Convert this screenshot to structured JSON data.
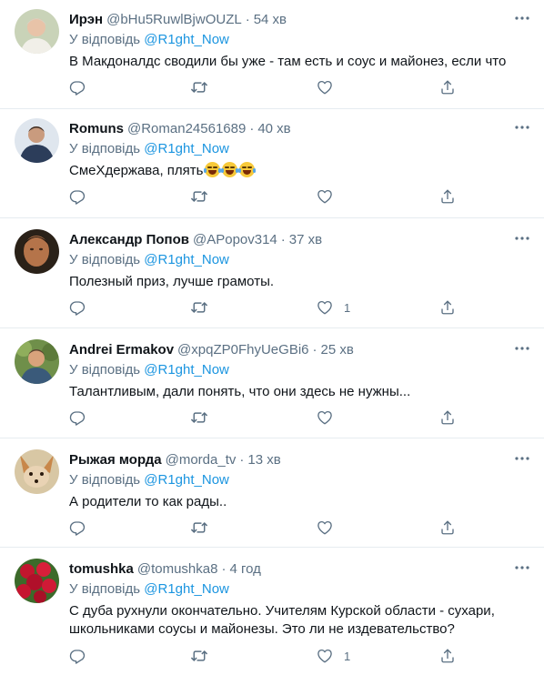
{
  "tweets": [
    {
      "name": "Ирэн",
      "handle": "@bHu5RuwlBjwOUZL",
      "time": "54 хв",
      "reply_prefix": "У відповідь",
      "reply_mention": "@R1ght_Now",
      "text": "В Макдоналдс сводили бы уже - там есть и соус и майонез, если что",
      "like_count": "",
      "avatar_icon": "avatar-photo-woman"
    },
    {
      "name": "Romuns",
      "handle": "@Roman24561689",
      "time": "40 хв",
      "reply_prefix": "У відповідь",
      "reply_mention": "@R1ght_Now",
      "text": "СмеХдержава, плять",
      "emoji_count": 3,
      "like_count": "",
      "avatar_icon": "avatar-photo-man"
    },
    {
      "name": "Александр Попов",
      "handle": "@APopov314",
      "time": "37 хв",
      "reply_prefix": "У відповідь",
      "reply_mention": "@R1ght_Now",
      "text": "Полезный приз, лучше грамоты.",
      "like_count": "1",
      "avatar_icon": "avatar-photo-man-dark"
    },
    {
      "name": "Andrei Ermakov",
      "handle": "@xpqZP0FhyUeGBi6",
      "time": "25 хв",
      "reply_prefix": "У відповідь",
      "reply_mention": "@R1ght_Now",
      "text": "Талантливым, дали понять, что они здесь не нужны...",
      "like_count": "",
      "avatar_icon": "avatar-photo-man-outdoor"
    },
    {
      "name": "Рыжая морда",
      "handle": "@morda_tv",
      "time": "13 хв",
      "reply_prefix": "У відповідь",
      "reply_mention": "@R1ght_Now",
      "text": "А родители то как рады..",
      "like_count": "",
      "avatar_icon": "avatar-photo-fox"
    },
    {
      "name": "tomushka",
      "handle": "@tomushka8",
      "time": "4 год",
      "reply_prefix": "У відповідь",
      "reply_mention": "@R1ght_Now",
      "text": "С дуба рухнули окончательно. Учителям Курской области - сухари, школьниками соусы и майонезы. Это ли не издевательство?",
      "like_count": "1",
      "avatar_icon": "avatar-photo-flowers"
    }
  ],
  "colors": {
    "text": "#0f1419",
    "secondary": "#5b7083",
    "link": "#1b95e0",
    "divider": "#e6ecf0"
  },
  "icons": [
    "reply-icon",
    "retweet-icon",
    "like-icon",
    "share-icon",
    "more-options-icon"
  ]
}
